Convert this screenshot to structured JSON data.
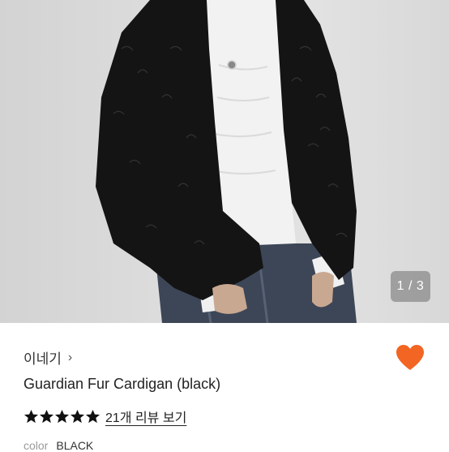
{
  "gallery": {
    "counter": "1 / 3",
    "image_alt_icon": "product-photo"
  },
  "product": {
    "shop_name": "이네기",
    "shop_chevron": "›",
    "title": "Guardian Fur Cardigan (black)",
    "rating": {
      "stars": 5,
      "max": 5
    },
    "review_link": "21개 리뷰 보기",
    "color_label": "color",
    "color_value": "BLACK"
  },
  "colors": {
    "heart": "#f26522",
    "star": "#111111"
  }
}
